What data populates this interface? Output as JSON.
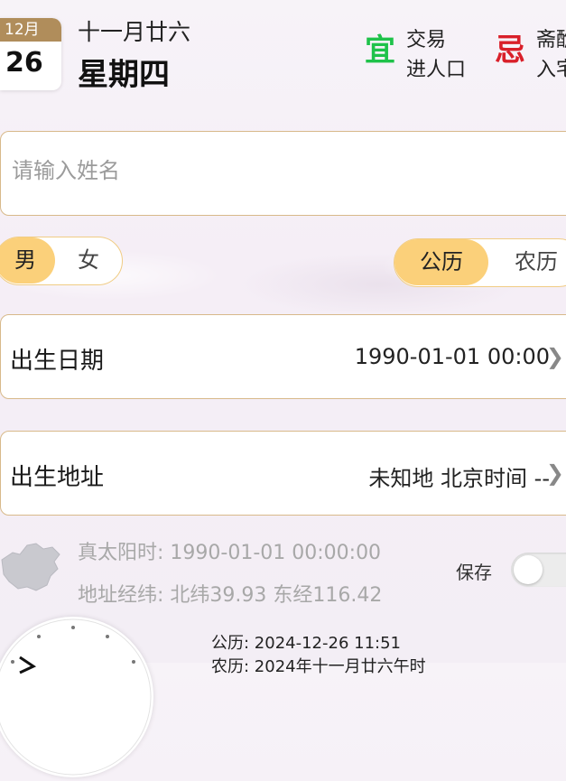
{
  "header": {
    "month": "12月",
    "day": "26",
    "lunar_date": "十一月廿六",
    "weekday": "星期四",
    "yi": {
      "mark": "宜",
      "items": [
        "交易",
        "进人口"
      ]
    },
    "ji": {
      "mark": "忌",
      "items": [
        "斋醮",
        "入宅"
      ]
    }
  },
  "name_field": {
    "placeholder": "请输入姓名",
    "value": ""
  },
  "gender": {
    "options": [
      "男",
      "女"
    ],
    "selected": "男"
  },
  "calendar_type": {
    "options": [
      "公历",
      "农历"
    ],
    "selected": "公历"
  },
  "birth_date": {
    "label": "出生日期",
    "value": "1990-01-01 00:00"
  },
  "birth_place": {
    "label": "出生地址",
    "value": "未知地 北京时间 --"
  },
  "info": {
    "true_solar": "真太阳时: 1990-01-01 00:00:00",
    "coords": "地址经纬: 北纬39.93 东经116.42",
    "save_label": "保存",
    "save_on": false
  },
  "now": {
    "solar": "公历: 2024-12-26 11:51",
    "lunar": "农历: 2024年十一月廿六午时"
  },
  "colors": {
    "accent": "#f0cc84",
    "active_fill": "#fbd07a",
    "yi": "#1fc24a",
    "ji": "#d9202a",
    "month_bar": "#b08d5b",
    "border": "#d8b98a"
  },
  "icons": {
    "chevron": "chevron-right-icon",
    "map": "china-map-icon",
    "clock": "clock-icon"
  }
}
